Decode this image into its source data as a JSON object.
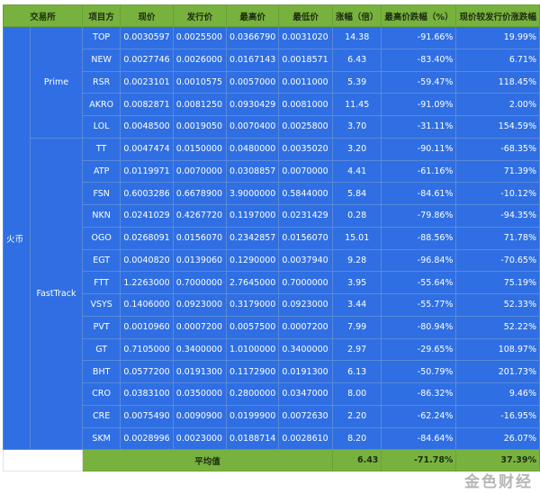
{
  "headers": [
    "交易所",
    "项目方",
    "现价",
    "发行价",
    "最高价",
    "最低价",
    "涨幅（倍）",
    "最高价跌幅（%）",
    "现价较发行价涨跌幅"
  ],
  "exchange": "火币",
  "groups": [
    {
      "name": "Prime",
      "rows": [
        [
          "TOP",
          "0.0030597",
          "0.0025500",
          "0.0366790",
          "0.0031020",
          "14.38",
          "-91.66%",
          "19.99%"
        ],
        [
          "NEW",
          "0.0027746",
          "0.0026000",
          "0.0167143",
          "0.0018571",
          "6.43",
          "-83.40%",
          "6.71%"
        ],
        [
          "RSR",
          "0.0023101",
          "0.0010575",
          "0.0057000",
          "0.0011000",
          "5.39",
          "-59.47%",
          "118.45%"
        ],
        [
          "AKRO",
          "0.0082871",
          "0.0081250",
          "0.0930429",
          "0.0081000",
          "11.45",
          "-91.09%",
          "2.00%"
        ],
        [
          "LOL",
          "0.0048500",
          "0.0019050",
          "0.0070400",
          "0.0025800",
          "3.70",
          "-31.11%",
          "154.59%"
        ]
      ]
    },
    {
      "name": "FastTrack",
      "rows": [
        [
          "TT",
          "0.0047474",
          "0.0150000",
          "0.0480000",
          "0.0035020",
          "3.20",
          "-90.11%",
          "-68.35%"
        ],
        [
          "ATP",
          "0.0119971",
          "0.0070000",
          "0.0308857",
          "0.0070000",
          "4.41",
          "-61.16%",
          "71.39%"
        ],
        [
          "FSN",
          "0.6003286",
          "0.6678900",
          "3.9000000",
          "0.5844000",
          "5.84",
          "-84.61%",
          "-10.12%"
        ],
        [
          "NKN",
          "0.0241029",
          "0.4267720",
          "0.1197000",
          "0.0231429",
          "0.28",
          "-79.86%",
          "-94.35%"
        ],
        [
          "OGO",
          "0.0268091",
          "0.0156070",
          "0.2342857",
          "0.0156070",
          "15.01",
          "-88.56%",
          "71.78%"
        ],
        [
          "EGT",
          "0.0040820",
          "0.0139060",
          "0.1290000",
          "0.0037940",
          "9.28",
          "-96.84%",
          "-70.65%"
        ],
        [
          "FTT",
          "1.2263000",
          "0.7000000",
          "2.7645000",
          "0.7000000",
          "3.95",
          "-55.64%",
          "75.19%"
        ],
        [
          "VSYS",
          "0.1406000",
          "0.0923000",
          "0.3179000",
          "0.0923000",
          "3.44",
          "-55.77%",
          "52.33%"
        ],
        [
          "PVT",
          "0.0010960",
          "0.0007200",
          "0.0057500",
          "0.0007200",
          "7.99",
          "-80.94%",
          "52.22%"
        ],
        [
          "GT",
          "0.7105000",
          "0.3400000",
          "1.0100000",
          "0.3400000",
          "2.97",
          "-29.65%",
          "108.97%"
        ],
        [
          "BHT",
          "0.0577200",
          "0.0191300",
          "0.1172900",
          "0.0191300",
          "6.13",
          "-50.79%",
          "201.73%"
        ],
        [
          "CRO",
          "0.0383100",
          "0.0350000",
          "0.2800000",
          "0.0347000",
          "8.00",
          "-86.32%",
          "9.46%"
        ],
        [
          "CRE",
          "0.0075490",
          "0.0090900",
          "0.0199900",
          "0.0072630",
          "2.20",
          "-62.24%",
          "-16.95%"
        ],
        [
          "SKM",
          "0.0028996",
          "0.0023000",
          "0.0188714",
          "0.0028610",
          "8.20",
          "-84.64%",
          "26.07%"
        ]
      ]
    }
  ],
  "footer": {
    "label": "平均值",
    "avg_multiple": "6.43",
    "avg_drop": "-71.78%",
    "avg_change": "37.39%"
  },
  "watermark": "金色财经"
}
